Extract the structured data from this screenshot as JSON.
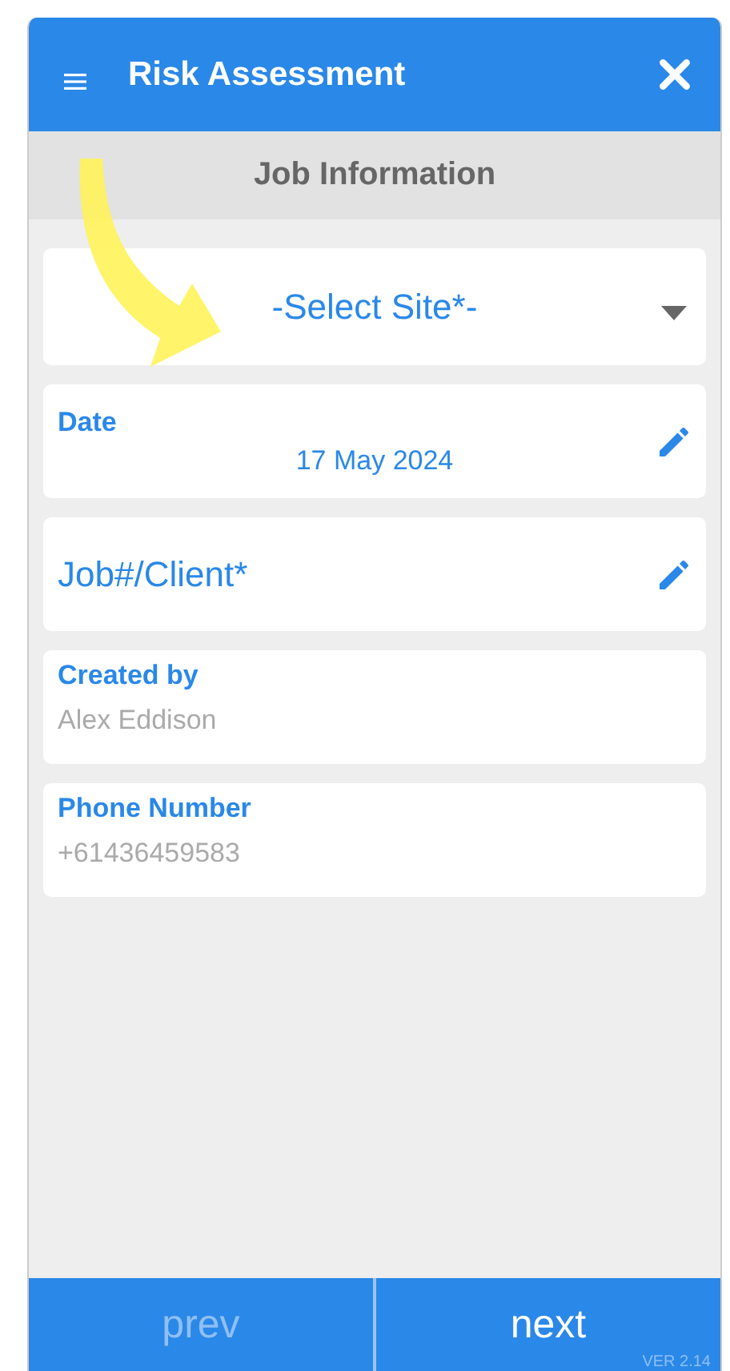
{
  "header": {
    "title": "Risk Assessment"
  },
  "section": {
    "title": "Job Information"
  },
  "fields": [
    {
      "kind": "select",
      "placeholder": "-Select Site*-"
    },
    {
      "kind": "editable",
      "label": "Date",
      "value": "17 May 2024"
    },
    {
      "kind": "editable",
      "placeholder": "Job#/Client*"
    },
    {
      "kind": "readonly",
      "label": "Created by",
      "value": "Alex Eddison"
    },
    {
      "kind": "readonly",
      "label": "Phone Number",
      "value": "+61436459583"
    }
  ],
  "footer": {
    "buttons": [
      {
        "label": "prev",
        "disabled": true
      },
      {
        "label": "next",
        "disabled": false
      }
    ],
    "version": "VER 2.14"
  }
}
